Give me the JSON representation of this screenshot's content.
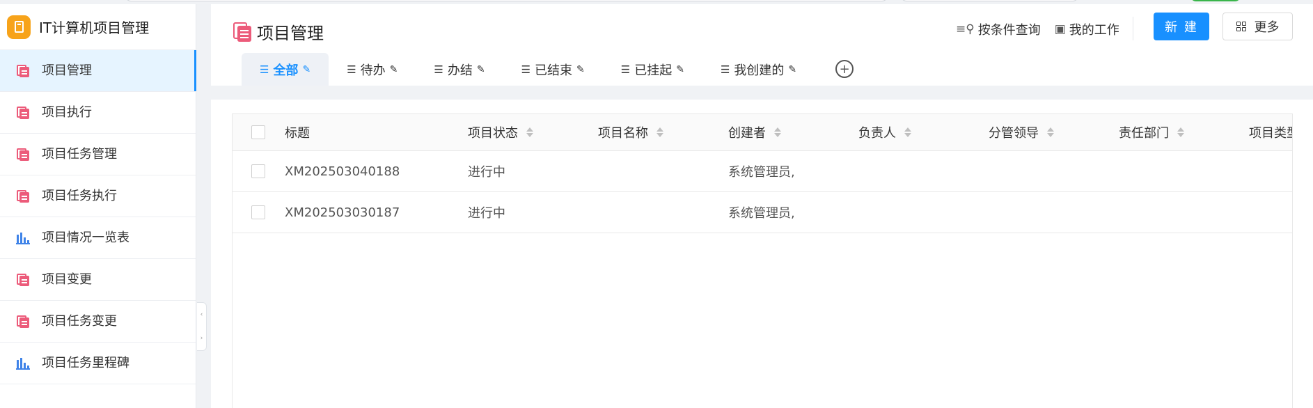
{
  "app": {
    "title": "IT计算机项目管理"
  },
  "sidebar": {
    "items": [
      {
        "label": "项目管理",
        "icon": "book-icon",
        "active": true
      },
      {
        "label": "项目执行",
        "icon": "book-icon"
      },
      {
        "label": "项目任务管理",
        "icon": "book-icon"
      },
      {
        "label": "项目任务执行",
        "icon": "book-icon"
      },
      {
        "label": "项目情况一览表",
        "icon": "bar-chart-icon"
      },
      {
        "label": "项目变更",
        "icon": "book-icon"
      },
      {
        "label": "项目任务变更",
        "icon": "book-icon"
      },
      {
        "label": "项目任务里程碑",
        "icon": "bar-chart-icon"
      }
    ]
  },
  "header": {
    "title": "项目管理",
    "query_label": "按条件查询",
    "mywork_label": "我的工作",
    "new_label": "新 建",
    "more_label": "更多"
  },
  "tabs": [
    {
      "label": "全部",
      "active": true
    },
    {
      "label": "待办"
    },
    {
      "label": "办结"
    },
    {
      "label": "已结束"
    },
    {
      "label": "已挂起"
    },
    {
      "label": "我创建的"
    }
  ],
  "table": {
    "columns": [
      "标题",
      "项目状态",
      "项目名称",
      "创建者",
      "负责人",
      "分管领导",
      "责任部门",
      "项目类型"
    ],
    "rows": [
      {
        "title": "XM202503040188",
        "status": "进行中",
        "name": "",
        "creator": "系统管理员,"
      },
      {
        "title": "XM202503030187",
        "status": "进行中",
        "name": "",
        "creator": "系统管理员,"
      }
    ]
  },
  "colors": {
    "accent": "#1890ff",
    "brand": "#f7a31a",
    "book": "#ec5b7a",
    "chart": "#3f83e8"
  }
}
